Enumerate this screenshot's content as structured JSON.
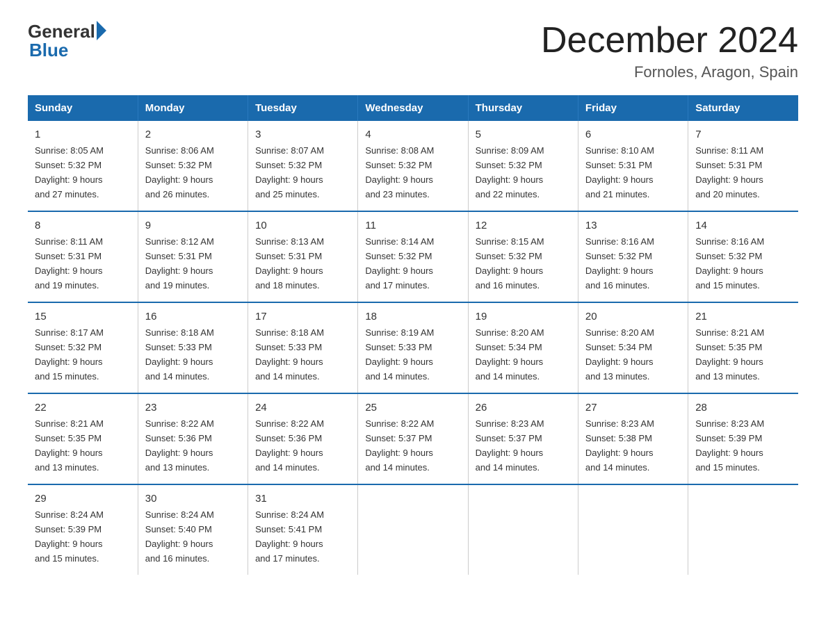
{
  "header": {
    "logo_general": "General",
    "logo_blue": "Blue",
    "title": "December 2024",
    "location": "Fornoles, Aragon, Spain"
  },
  "days_of_week": [
    "Sunday",
    "Monday",
    "Tuesday",
    "Wednesday",
    "Thursday",
    "Friday",
    "Saturday"
  ],
  "weeks": [
    [
      {
        "day": "1",
        "sunrise": "8:05 AM",
        "sunset": "5:32 PM",
        "daylight": "9 hours and 27 minutes."
      },
      {
        "day": "2",
        "sunrise": "8:06 AM",
        "sunset": "5:32 PM",
        "daylight": "9 hours and 26 minutes."
      },
      {
        "day": "3",
        "sunrise": "8:07 AM",
        "sunset": "5:32 PM",
        "daylight": "9 hours and 25 minutes."
      },
      {
        "day": "4",
        "sunrise": "8:08 AM",
        "sunset": "5:32 PM",
        "daylight": "9 hours and 23 minutes."
      },
      {
        "day": "5",
        "sunrise": "8:09 AM",
        "sunset": "5:32 PM",
        "daylight": "9 hours and 22 minutes."
      },
      {
        "day": "6",
        "sunrise": "8:10 AM",
        "sunset": "5:31 PM",
        "daylight": "9 hours and 21 minutes."
      },
      {
        "day": "7",
        "sunrise": "8:11 AM",
        "sunset": "5:31 PM",
        "daylight": "9 hours and 20 minutes."
      }
    ],
    [
      {
        "day": "8",
        "sunrise": "8:11 AM",
        "sunset": "5:31 PM",
        "daylight": "9 hours and 19 minutes."
      },
      {
        "day": "9",
        "sunrise": "8:12 AM",
        "sunset": "5:31 PM",
        "daylight": "9 hours and 19 minutes."
      },
      {
        "day": "10",
        "sunrise": "8:13 AM",
        "sunset": "5:31 PM",
        "daylight": "9 hours and 18 minutes."
      },
      {
        "day": "11",
        "sunrise": "8:14 AM",
        "sunset": "5:32 PM",
        "daylight": "9 hours and 17 minutes."
      },
      {
        "day": "12",
        "sunrise": "8:15 AM",
        "sunset": "5:32 PM",
        "daylight": "9 hours and 16 minutes."
      },
      {
        "day": "13",
        "sunrise": "8:16 AM",
        "sunset": "5:32 PM",
        "daylight": "9 hours and 16 minutes."
      },
      {
        "day": "14",
        "sunrise": "8:16 AM",
        "sunset": "5:32 PM",
        "daylight": "9 hours and 15 minutes."
      }
    ],
    [
      {
        "day": "15",
        "sunrise": "8:17 AM",
        "sunset": "5:32 PM",
        "daylight": "9 hours and 15 minutes."
      },
      {
        "day": "16",
        "sunrise": "8:18 AM",
        "sunset": "5:33 PM",
        "daylight": "9 hours and 14 minutes."
      },
      {
        "day": "17",
        "sunrise": "8:18 AM",
        "sunset": "5:33 PM",
        "daylight": "9 hours and 14 minutes."
      },
      {
        "day": "18",
        "sunrise": "8:19 AM",
        "sunset": "5:33 PM",
        "daylight": "9 hours and 14 minutes."
      },
      {
        "day": "19",
        "sunrise": "8:20 AM",
        "sunset": "5:34 PM",
        "daylight": "9 hours and 14 minutes."
      },
      {
        "day": "20",
        "sunrise": "8:20 AM",
        "sunset": "5:34 PM",
        "daylight": "9 hours and 13 minutes."
      },
      {
        "day": "21",
        "sunrise": "8:21 AM",
        "sunset": "5:35 PM",
        "daylight": "9 hours and 13 minutes."
      }
    ],
    [
      {
        "day": "22",
        "sunrise": "8:21 AM",
        "sunset": "5:35 PM",
        "daylight": "9 hours and 13 minutes."
      },
      {
        "day": "23",
        "sunrise": "8:22 AM",
        "sunset": "5:36 PM",
        "daylight": "9 hours and 13 minutes."
      },
      {
        "day": "24",
        "sunrise": "8:22 AM",
        "sunset": "5:36 PM",
        "daylight": "9 hours and 14 minutes."
      },
      {
        "day": "25",
        "sunrise": "8:22 AM",
        "sunset": "5:37 PM",
        "daylight": "9 hours and 14 minutes."
      },
      {
        "day": "26",
        "sunrise": "8:23 AM",
        "sunset": "5:37 PM",
        "daylight": "9 hours and 14 minutes."
      },
      {
        "day": "27",
        "sunrise": "8:23 AM",
        "sunset": "5:38 PM",
        "daylight": "9 hours and 14 minutes."
      },
      {
        "day": "28",
        "sunrise": "8:23 AM",
        "sunset": "5:39 PM",
        "daylight": "9 hours and 15 minutes."
      }
    ],
    [
      {
        "day": "29",
        "sunrise": "8:24 AM",
        "sunset": "5:39 PM",
        "daylight": "9 hours and 15 minutes."
      },
      {
        "day": "30",
        "sunrise": "8:24 AM",
        "sunset": "5:40 PM",
        "daylight": "9 hours and 16 minutes."
      },
      {
        "day": "31",
        "sunrise": "8:24 AM",
        "sunset": "5:41 PM",
        "daylight": "9 hours and 17 minutes."
      },
      null,
      null,
      null,
      null
    ]
  ],
  "labels": {
    "sunrise_prefix": "Sunrise: ",
    "sunset_prefix": "Sunset: ",
    "daylight_prefix": "Daylight: "
  }
}
